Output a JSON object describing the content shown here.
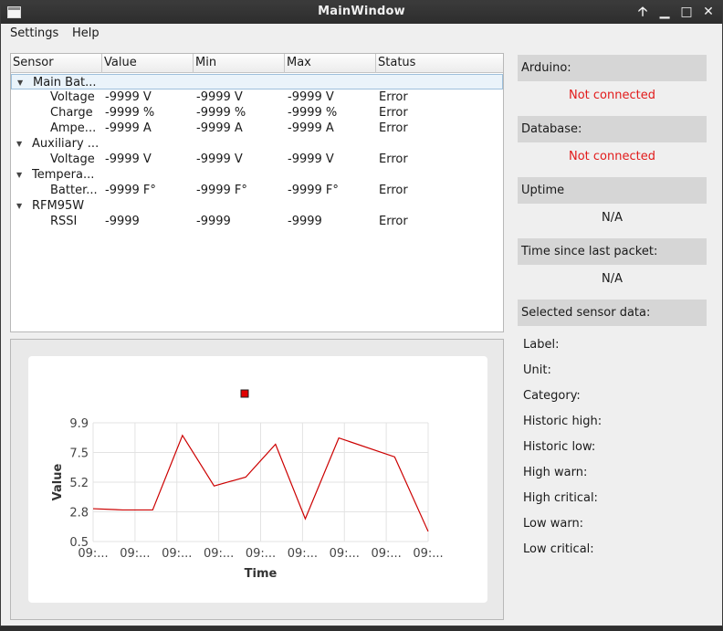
{
  "window": {
    "title": "MainWindow"
  },
  "titlebar": {
    "up_glyph": "🡡",
    "min_glyph": "▁",
    "max_glyph": "□",
    "close_glyph": "✕"
  },
  "menu": {
    "settings": "Settings",
    "help": "Help"
  },
  "tree": {
    "headers": [
      "Sensor",
      "Value",
      "Min",
      "Max",
      "Status"
    ],
    "rows": [
      {
        "level": 0,
        "name": "Main Bat...",
        "value": "",
        "min": "",
        "max": "",
        "status": ""
      },
      {
        "level": 1,
        "name": "Voltage",
        "value": "-9999 V",
        "min": "-9999 V",
        "max": "-9999 V",
        "status": "Error"
      },
      {
        "level": 1,
        "name": "Charge",
        "value": "-9999 %",
        "min": "-9999 %",
        "max": "-9999 %",
        "status": "Error"
      },
      {
        "level": 1,
        "name": "Ampe...",
        "value": "-9999 A",
        "min": "-9999 A",
        "max": "-9999 A",
        "status": "Error"
      },
      {
        "level": 0,
        "name": "Auxiliary ...",
        "value": "",
        "min": "",
        "max": "",
        "status": ""
      },
      {
        "level": 1,
        "name": "Voltage",
        "value": "-9999 V",
        "min": "-9999 V",
        "max": "-9999 V",
        "status": "Error"
      },
      {
        "level": 0,
        "name": "Tempera...",
        "value": "",
        "min": "",
        "max": "",
        "status": ""
      },
      {
        "level": 1,
        "name": "Batter...",
        "value": "-9999 F°",
        "min": "-9999 F°",
        "max": "-9999 F°",
        "status": "Error"
      },
      {
        "level": 0,
        "name": "RFM95W",
        "value": "",
        "min": "",
        "max": "",
        "status": ""
      },
      {
        "level": 1,
        "name": "RSSI",
        "value": "-9999",
        "min": "-9999",
        "max": "-9999",
        "status": "Error"
      }
    ]
  },
  "chart_data": {
    "type": "line",
    "title": "",
    "xlabel": "Time",
    "ylabel": "Value",
    "ylim": [
      0.5,
      9.9
    ],
    "y_ticks": [
      "9.9",
      "7.5",
      "5.2",
      "2.8",
      "0.5"
    ],
    "x_tick_labels": [
      "09:...",
      "09:...",
      "09:...",
      "09:...",
      "09:...",
      "09:...",
      "09:...",
      "09:...",
      "09:..."
    ],
    "legend_marker_color": "#e00000",
    "series": [
      {
        "color": "#cc0000",
        "x": [
          0,
          0.8,
          1.6,
          2.4,
          3.25,
          4.1,
          4.9,
          5.7,
          6.6,
          8.1,
          9.0
        ],
        "y": [
          3.1,
          3.0,
          3.0,
          8.9,
          4.9,
          5.6,
          8.2,
          2.3,
          8.7,
          7.2,
          1.3
        ]
      }
    ]
  },
  "status_panel": {
    "arduino_label": "Arduino:",
    "arduino_value": "Not connected",
    "database_label": "Database:",
    "database_value": "Not connected",
    "uptime_label": "Uptime",
    "uptime_value": "N/A",
    "last_packet_label": "Time since last packet:",
    "last_packet_value": "N/A",
    "selected_label": "Selected sensor data:",
    "status_color": "#e21b1b"
  },
  "sensor_details": [
    "Label:",
    "Unit:",
    "Category:",
    "Historic high:",
    "Historic low:",
    "High warn:",
    "High critical:",
    "Low warn:",
    "Low critical:"
  ]
}
